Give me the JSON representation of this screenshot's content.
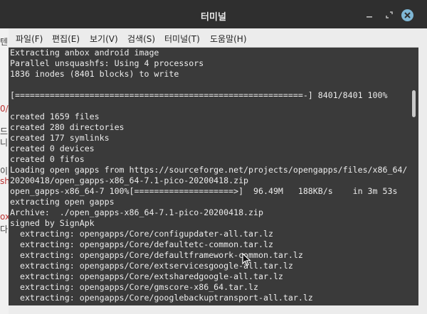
{
  "window": {
    "title": "터미널"
  },
  "menu": [
    {
      "label": "파일(F)"
    },
    {
      "label": "편집(E)"
    },
    {
      "label": "보기(V)"
    },
    {
      "label": "검색(S)"
    },
    {
      "label": "터미널(T)"
    },
    {
      "label": "도움말(H)"
    }
  ],
  "terminal": {
    "lines": [
      "Extracting anbox android image",
      "Parallel unsquashfs: Using 4 processors",
      "1836 inodes (8401 blocks) to write",
      "",
      "[==========================================================-] 8401/8401 100%",
      "",
      "created 1659 files",
      "created 280 directories",
      "created 177 symlinks",
      "created 0 devices",
      "created 0 fifos",
      "Loading open gapps from https://sourceforge.net/projects/opengapps/files/x86_64/",
      "20200418/open_gapps-x86_64-7.1-pico-20200418.zip",
      "open_gapps-x86_64-7 100%[====================>]  96.49M   188KB/s    in 3m 53s",
      "extracting open gapps",
      "Archive:  ./open_gapps-x86_64-7.1-pico-20200418.zip",
      "signed by SignApk",
      "  extracting: opengapps/Core/configupdater-all.tar.lz",
      "  extracting: opengapps/Core/defaultetc-common.tar.lz",
      "  extracting: opengapps/Core/defaultframework-common.tar.lz",
      "  extracting: opengapps/Core/extservicesgoogle-all.tar.lz",
      "  extracting: opengapps/Core/extsharedgoogle-all.tar.lz",
      "  extracting: opengapps/Core/gmscore-x86_64.tar.lz",
      "  extracting: opengapps/Core/googlebackuptransport-all.tar.lz"
    ]
  },
  "background": {
    "fragments": [
      {
        "text": "텐"
      },
      {
        "text": "0/"
      },
      {
        "text": "드"
      },
      {
        "text": "니"
      },
      {
        "text": "이"
      },
      {
        "text": "sh"
      },
      {
        "text": "ox"
      },
      {
        "text": "다"
      }
    ]
  },
  "icons": {
    "minimize": "minimize-icon",
    "maximize": "maximize-icon",
    "close": "close-icon",
    "pointer": "mouse-pointer-icon"
  },
  "colors": {
    "titlebar": "#2f2f2f",
    "terminal_bg": "#3a3a3a",
    "terminal_fg": "#ececec",
    "close_button": "#7fb7d5"
  }
}
